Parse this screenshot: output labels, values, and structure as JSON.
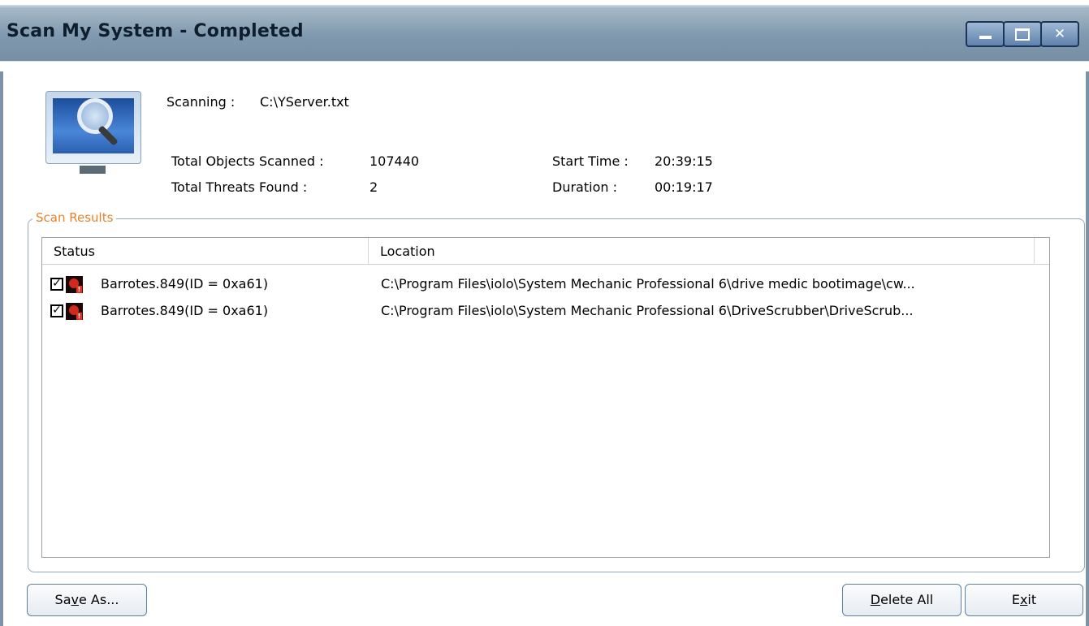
{
  "window": {
    "title": "Scan My System - Completed",
    "controls": [
      "minimize-icon",
      "maximize-icon",
      "close-icon"
    ]
  },
  "scan": {
    "scanning_label": "Scanning :",
    "scanning_value": "C:\\YServer.txt",
    "total_objects_label": "Total Objects Scanned :",
    "total_objects_value": "107440",
    "total_threats_label": "Total Threats Found :",
    "total_threats_value": "2",
    "start_time_label": "Start Time :",
    "start_time_value": "20:39:15",
    "duration_label": "Duration :",
    "duration_value": "00:19:17"
  },
  "results": {
    "group_title": "Scan Results",
    "columns": [
      "Status",
      "Location"
    ],
    "rows": [
      {
        "checked": true,
        "name": "Barrotes.849(ID = 0xa61)",
        "location": "C:\\Program Files\\iolo\\System Mechanic Professional 6\\drive medic bootimage\\cw..."
      },
      {
        "checked": true,
        "name": "Barrotes.849(ID = 0xa61)",
        "location": "C:\\Program Files\\iolo\\System Mechanic Professional 6\\DriveScrubber\\DriveScrub..."
      }
    ]
  },
  "buttons": {
    "save_as_pre": "Sa",
    "save_as_ul": "v",
    "save_as_post": "e As...",
    "delete_all_ul": "D",
    "delete_all_post": "elete All",
    "exit_pre": "E",
    "exit_ul": "x",
    "exit_post": "it"
  },
  "colors": {
    "group_title": "#e9822b",
    "titlebar": "#7f98ad",
    "threat_icon": "#d12a1c"
  }
}
